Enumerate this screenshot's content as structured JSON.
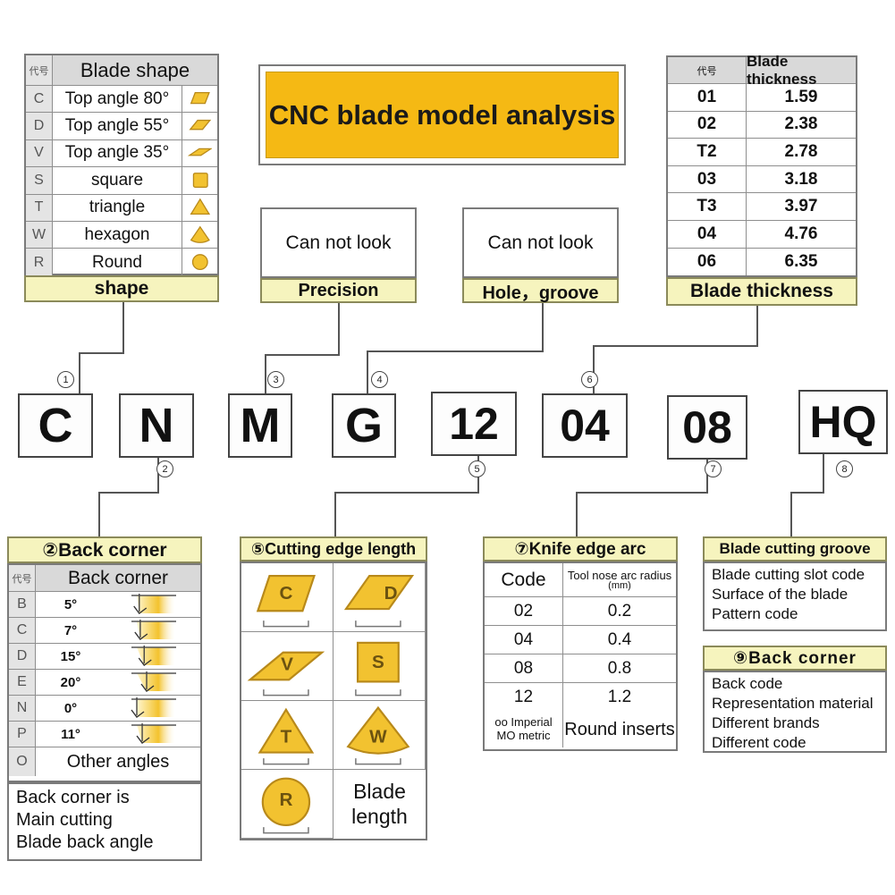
{
  "title": {
    "text": "CNC blade model analysis"
  },
  "code_label": "代号",
  "blade_shape": {
    "header_code": "代号",
    "header_title": "Blade shape",
    "footer": "shape",
    "rows": [
      {
        "code": "C",
        "label": "Top angle 80°",
        "icon": "rhombus-80-icon"
      },
      {
        "code": "D",
        "label": "Top angle 55°",
        "icon": "rhombus-55-icon"
      },
      {
        "code": "V",
        "label": "Top angle 35°",
        "icon": "rhombus-35-icon"
      },
      {
        "code": "S",
        "label": "square",
        "icon": "square-icon"
      },
      {
        "code": "T",
        "label": "triangle",
        "icon": "triangle-icon"
      },
      {
        "code": "W",
        "label": "hexagon",
        "icon": "hexagon-icon"
      },
      {
        "code": "R",
        "label": "Round",
        "icon": "circle-icon"
      }
    ]
  },
  "precision": {
    "body": "Can not look",
    "footer": "Precision"
  },
  "hole_groove": {
    "body": "Can not look",
    "footer": "Hole，groove"
  },
  "thickness": {
    "header_code": "代号",
    "header_title": "Blade thickness",
    "footer": "Blade thickness",
    "rows": [
      {
        "code": "01",
        "value": "1.59"
      },
      {
        "code": "02",
        "value": "2.38"
      },
      {
        "code": "T2",
        "value": "2.78"
      },
      {
        "code": "03",
        "value": "3.18"
      },
      {
        "code": "T3",
        "value": "3.97"
      },
      {
        "code": "04",
        "value": "4.76"
      },
      {
        "code": "06",
        "value": "6.35"
      }
    ]
  },
  "model_code": {
    "segments": [
      {
        "char": "C",
        "marker": "①"
      },
      {
        "char": "N",
        "marker": "②"
      },
      {
        "char": "M",
        "marker": "③"
      },
      {
        "char": "G",
        "marker": "④"
      },
      {
        "char": "12",
        "marker": "⑤"
      },
      {
        "char": "04",
        "marker": "⑥"
      },
      {
        "char": "08",
        "marker": "⑦"
      },
      {
        "char": "HQ",
        "marker": "⑧"
      }
    ]
  },
  "back_corner": {
    "title": "②Back corner",
    "header_code": "代号",
    "header_title": "Back corner",
    "rows": [
      {
        "code": "B",
        "angle": "5°"
      },
      {
        "code": "C",
        "angle": "7°"
      },
      {
        "code": "D",
        "angle": "15°"
      },
      {
        "code": "E",
        "angle": "20°"
      },
      {
        "code": "N",
        "angle": "0°"
      },
      {
        "code": "P",
        "angle": "11°"
      }
    ],
    "other_code": "O",
    "other_label": "Other angles",
    "notes": [
      "Back corner is",
      "Main cutting",
      "Blade back angle"
    ]
  },
  "cutting_edge": {
    "title": "⑤Cutting edge length",
    "cells": [
      {
        "glyph": "C",
        "icon": "rhombus-80-icon"
      },
      {
        "glyph": "D",
        "icon": "rhombus-55-icon"
      },
      {
        "glyph": "V",
        "icon": "rhombus-35-icon"
      },
      {
        "glyph": "S",
        "icon": "square-icon"
      },
      {
        "glyph": "T",
        "icon": "triangle-icon"
      },
      {
        "glyph": "W",
        "icon": "hexagon-icon"
      },
      {
        "glyph": "R",
        "icon": "circle-icon"
      }
    ],
    "last_label": "Blade\nlength"
  },
  "knife_edge": {
    "title": "⑦Knife edge arc",
    "col1": "Code",
    "col2": "Tool nose arc radius",
    "col2_unit": "(mm)",
    "rows": [
      {
        "code": "02",
        "radius": "0.2"
      },
      {
        "code": "04",
        "radius": "0.4"
      },
      {
        "code": "08",
        "radius": "0.8"
      },
      {
        "code": "12",
        "radius": "1.2"
      }
    ],
    "footer_left_1": "oo Imperial",
    "footer_left_2": "MO metric",
    "footer_right": "Round inserts"
  },
  "cutting_groove": {
    "title": "Blade cutting groove",
    "lines": [
      "Blade cutting slot code",
      "Surface of the blade",
      "Pattern code"
    ]
  },
  "back_corner9": {
    "title": "⑨Back corner",
    "lines": [
      "Back code",
      "Representation material",
      "Different brands",
      "Different code"
    ]
  },
  "colors": {
    "gold": "#f5b914",
    "pale_yellow": "#f6f4be",
    "icon_gold": "#f2c230",
    "icon_outline": "#b8891a",
    "border": "#7a7a7a",
    "grey_header": "#d9d9d9"
  }
}
